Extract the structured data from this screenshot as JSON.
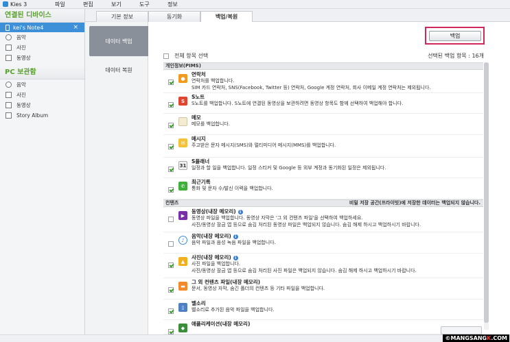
{
  "window": {
    "app_title": "Kies 3"
  },
  "menu": [
    "파일",
    "편집",
    "보기",
    "도구",
    "정보"
  ],
  "sidebar": {
    "connected_header": "연결된 디바이스",
    "device": {
      "name": "kei's Note4",
      "close": "×"
    },
    "device_items": [
      "음악",
      "사진",
      "동영상"
    ],
    "pc_header": "PC 보관함",
    "pc_items": [
      "음악",
      "사진",
      "동영상",
      "Story Album"
    ]
  },
  "tabs": [
    "기본 정보",
    "동기화",
    "백업/복원"
  ],
  "leftnav": {
    "backup": "데이터 백업",
    "restore": "데이터 복원"
  },
  "toolbar": {
    "backup_button": "백업"
  },
  "select_all": "전체 항목 선택",
  "selected_count": "선택된 백업 항목 : 16개",
  "sections": {
    "pims": "개인정보(PIMS)",
    "contents": "컨텐츠",
    "contents_note": "비밀 저장 공간(프라이빗)에 저장한 데이터는 백업되지 않습니다."
  },
  "pims_items": [
    {
      "title": "연락처",
      "desc1": "연락처를 백업합니다.",
      "desc2": "SIM 카드 연락처, SNS(Facebook, Twitter 등) 연락처, Google 계정 연락처, 회사 이메일 계정 연락처는 제외됩니다.",
      "icon": "contacts-icon",
      "color": "#f29a1f"
    },
    {
      "title": "S노트",
      "desc1": "S노트를 백업합니다. S노트에 연결된 동영상을 보관하려면 동영상 항목도 함께 선택하여 백업해야 합니다.",
      "desc2": "",
      "icon": "snote-icon",
      "color": "#e0452e"
    },
    {
      "title": "메모",
      "desc1": "메모를 백업합니다.",
      "desc2": "",
      "icon": "memo-icon",
      "color": "#f4ecd0"
    },
    {
      "title": "메시지",
      "desc1": "주고받은 문자 메시지(SMS)와 멀티미디어 메시지(MMS)를 백업합니다.",
      "desc2": "",
      "icon": "message-icon",
      "color": "#f3c13a"
    },
    {
      "title": "S플래너",
      "desc1": "일정과 할 일을 백업합니다. 일정 스티커 및 Google 등 외부 계정과 동기화된 일정은 제외됩니다.",
      "desc2": "",
      "icon": "calendar-icon",
      "color": "#7a7f86",
      "glyph": "31"
    },
    {
      "title": "최근기록",
      "desc1": "통화 및 문자 수/발신 이력을 백업합니다.",
      "desc2": "",
      "icon": "call-log-icon",
      "color": "#3fae3a"
    }
  ],
  "content_items": [
    {
      "title": "동영상(내장 메모리)",
      "desc1": "동영상 파일을 백업합니다. 동영상 자막은 '그 외 컨텐츠 파일'을 선택하여 백업하세요.",
      "desc2": "사진/동영상 잠금 앱 등으로 숨김 처리된 동영상 파일은 백업되지 않습니다. 숨김 해제 하시고 백업하시기 바랍니다.",
      "icon": "video-icon",
      "color": "#7a2fa8",
      "info": "i"
    },
    {
      "title": "음악(내장 메모리)",
      "desc1": "음악 파일과 음성 녹음 파일을 백업합니다.",
      "desc2": "",
      "icon": "music-icon",
      "color": "#3b8bd6",
      "info": "i"
    },
    {
      "title": "사진(내장 메모리)",
      "desc1": "사진 파일을 백업합니다.",
      "desc2": "사진/동영상 잠금 앱 등으로 숨김 처리된 사진 파일은 백업되지 않습니다. 숨김 해제 하시고 백업하시기 바랍니다.",
      "icon": "photo-icon",
      "color": "#f2b01e",
      "info": "i"
    },
    {
      "title": "그 외 컨텐츠 파일(내장 메모리)",
      "desc1": "문서, 동영상 자막, 숨긴 폴더의 컨텐츠 등 기타 파일을 백업합니다.",
      "desc2": "",
      "icon": "folder-icon",
      "color": "#f08a2a"
    },
    {
      "title": "벨소리",
      "desc1": "벨소리로 추가된 음악 파일을 백업합니다.",
      "desc2": "",
      "icon": "ringtone-icon",
      "color": "#4f7fc0"
    },
    {
      "title": "애플리케이션(내장 메모리)",
      "desc1": "",
      "desc2": "",
      "icon": "app-icon",
      "color": "#3a8e3a"
    }
  ],
  "watermark": {
    "a": "©MANGSANG",
    "b": "K",
    "c": ".COM"
  }
}
